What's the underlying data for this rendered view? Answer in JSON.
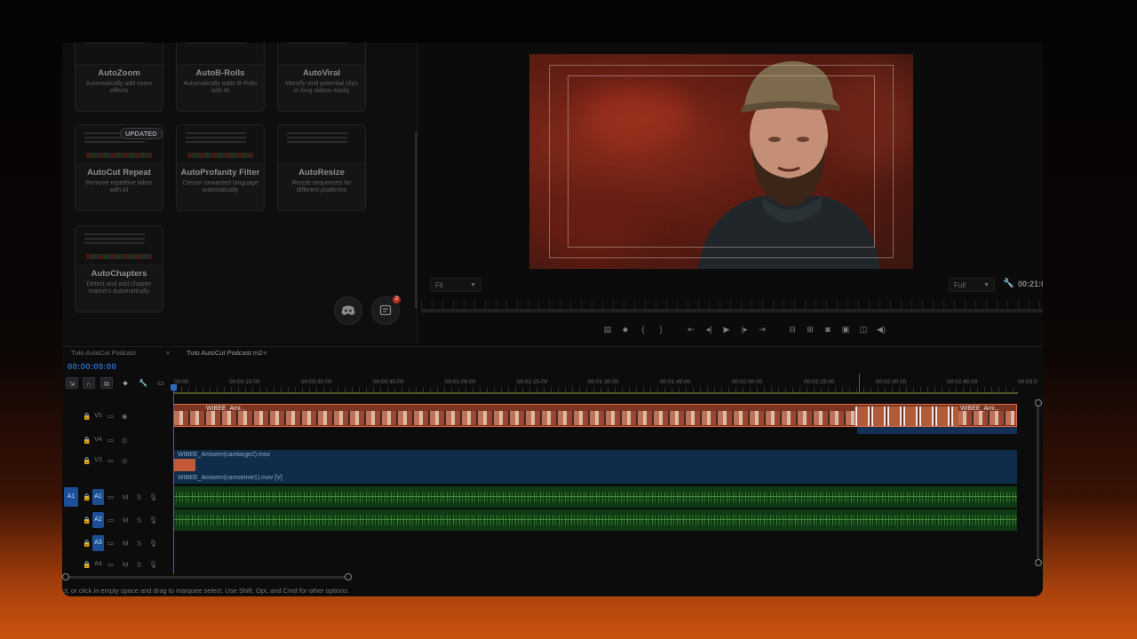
{
  "plugins": [
    {
      "title": "AutoZoom",
      "desc": "Automatically add zoom effects"
    },
    {
      "title": "AutoB-Rolls",
      "desc": "Automatically adds B-Rolls with AI"
    },
    {
      "title": "AutoViral",
      "desc": "Identify viral potential clips in long videos easily"
    },
    {
      "title": "AutoCut Repeat",
      "desc": "Remove repetitive takes with AI",
      "badge": "UPDATED"
    },
    {
      "title": "AutoProfanity Filter",
      "desc": "Censor unwanted language automatically"
    },
    {
      "title": "AutoResize",
      "desc": "Resize sequences for different platforms"
    },
    {
      "title": "AutoChapters",
      "desc": "Detect and add chapter markers automatically"
    }
  ],
  "notification_count": "2",
  "monitor": {
    "fit_select": "Fit",
    "quality_select": "Full",
    "timecode": "00:21:0"
  },
  "timeline": {
    "tabs": [
      "Tuto AutoCut Podcast",
      "Tuto AutoCut Podcast m2"
    ],
    "timecode": "00:00:00:00",
    "ruler": [
      "00:00",
      "00:00:15:00",
      "00:00:30:00",
      "00:00:45:00",
      "00:01:00:00",
      "00:01:15:00",
      "00:01:30:00",
      "00:01:45:00",
      "00:02:00:00",
      "00:02:15:00",
      "00:02:30:00",
      "00:02:45:00",
      "00:03:0"
    ],
    "video_tracks": [
      "V5",
      "V4",
      "V3"
    ],
    "audio_tracks": [
      "A1",
      "A2",
      "A3",
      "A4"
    ],
    "audio_source": "A1",
    "clips": {
      "v5_label_left": "WIBEE_Ami...",
      "v5_label_right": "WIBEE_Ami...",
      "v3_label_1": "WIBEE_Amisem(camlarge2).mov",
      "v3_label_2": "WIBEE_Amisem(camsemie1).mov [V]"
    },
    "status": "ct, or click in empty space and drag to marquee select. Use Shift, Opt, and Cmd for other options."
  },
  "colors": {
    "accent_blue": "#2d6ac0",
    "clip_selected_border": "#e36a45",
    "audio_clip": "#0f3a14",
    "video_clip_blue": "#0f2d4a"
  }
}
